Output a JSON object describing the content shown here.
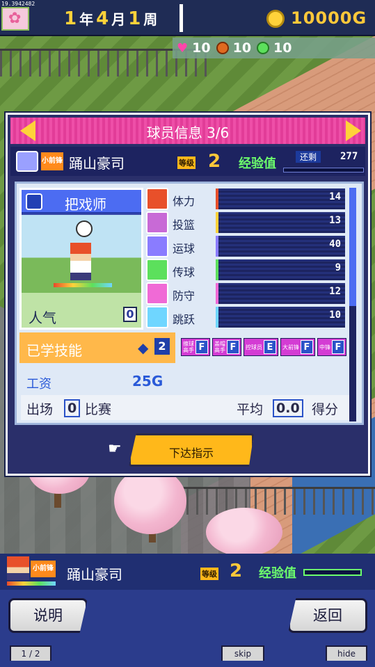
{
  "version": "19.3942482",
  "date": {
    "year": "1",
    "year_unit": "年",
    "month": "4",
    "month_unit": "月",
    "week": "1",
    "week_unit": "周"
  },
  "money": "10000G",
  "top_stats": [
    {
      "icon": "heart-icon",
      "value": "10"
    },
    {
      "icon": "basketball-icon",
      "value": "10"
    },
    {
      "icon": "smile-icon",
      "value": "10"
    }
  ],
  "dialog": {
    "title": "球员信息 3/6",
    "player": {
      "position_badge": "小前锋",
      "name": "踊山豪司",
      "level_label": "等级",
      "level": "2",
      "exp_label": "经验值",
      "remain_label": "还剩",
      "remain_value": "277"
    },
    "job": "把戏师",
    "popularity_label": "人气",
    "popularity_value": "0",
    "stats": [
      {
        "label": "体力",
        "value": "14",
        "color": "#e8502a"
      },
      {
        "label": "投篮",
        "value": "13",
        "color": "#ffd23a"
      },
      {
        "label": "运球",
        "value": "40",
        "color": "#8a7cff"
      },
      {
        "label": "传球",
        "value": "9",
        "color": "#5ce05c"
      },
      {
        "label": "防守",
        "value": "12",
        "color": "#f06ad6"
      },
      {
        "label": "跳跃",
        "value": "10",
        "color": "#6fd6ff"
      }
    ],
    "skills_label": "已学技能",
    "skills_count": "2",
    "skill_chips": [
      {
        "text": "擦球\n高手",
        "grade": "F"
      },
      {
        "text": "盖帽\n高手",
        "grade": "F"
      },
      {
        "text": "控球员",
        "grade": "E"
      },
      {
        "text": "大前锋",
        "grade": "F"
      },
      {
        "text": "中锋",
        "grade": "F"
      }
    ],
    "salary_label": "工资",
    "salary_value": "25G",
    "games_label_pre": "出场",
    "games_count": "0",
    "games_label_post": "比赛",
    "avg_label": "平均",
    "avg_value": "0.0",
    "avg_unit": "得分",
    "command_button": "下达指示"
  },
  "bottom_player": {
    "position_badge": "小前锋",
    "name": "踊山豪司",
    "level_label": "等级",
    "level": "2",
    "exp_label": "经验值"
  },
  "buttons": {
    "help": "说明",
    "back": "返回"
  },
  "tabs": {
    "page": "1 / 2",
    "skip": "skip",
    "hide": "hide"
  }
}
